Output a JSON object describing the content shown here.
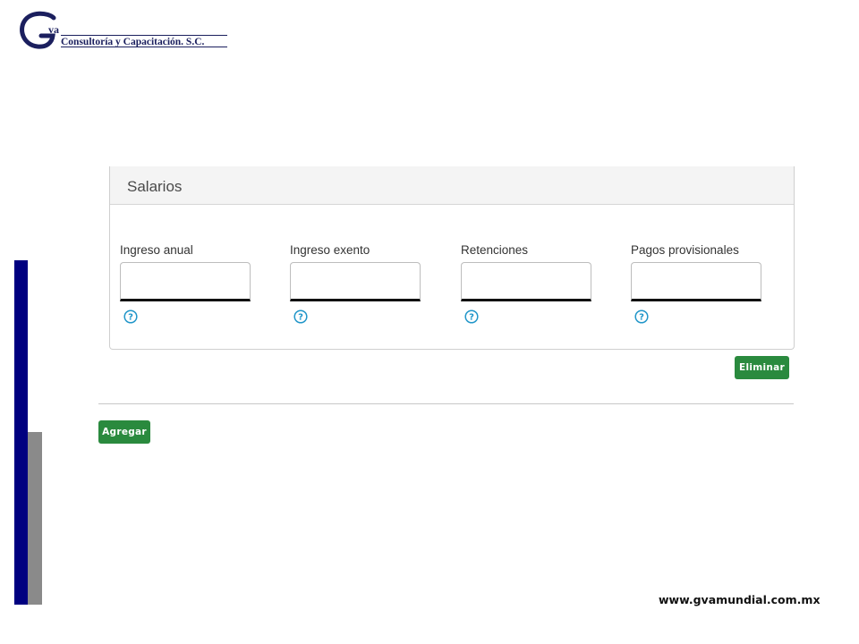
{
  "logo": {
    "initials": "va",
    "subtitle": "Consultoría y Capacitación. S.C."
  },
  "panel": {
    "title": "Salarios",
    "fields": [
      {
        "label": "Ingreso anual",
        "value": ""
      },
      {
        "label": "Ingreso exento",
        "value": ""
      },
      {
        "label": "Retenciones",
        "value": ""
      },
      {
        "label": "Pagos provisionales",
        "value": ""
      }
    ],
    "help_icon": "question-circle-icon"
  },
  "buttons": {
    "delete_label": "Eliminar",
    "add_label": "Agregar"
  },
  "footer": {
    "url": "www.gvamundial.com.mx"
  },
  "colors": {
    "accent_green": "#2a8a3e",
    "help_blue": "#2196c9",
    "side_bar_blue": "#000080",
    "side_bar_gray": "#8a8a8a",
    "logo_navy": "#1b1f5e"
  }
}
